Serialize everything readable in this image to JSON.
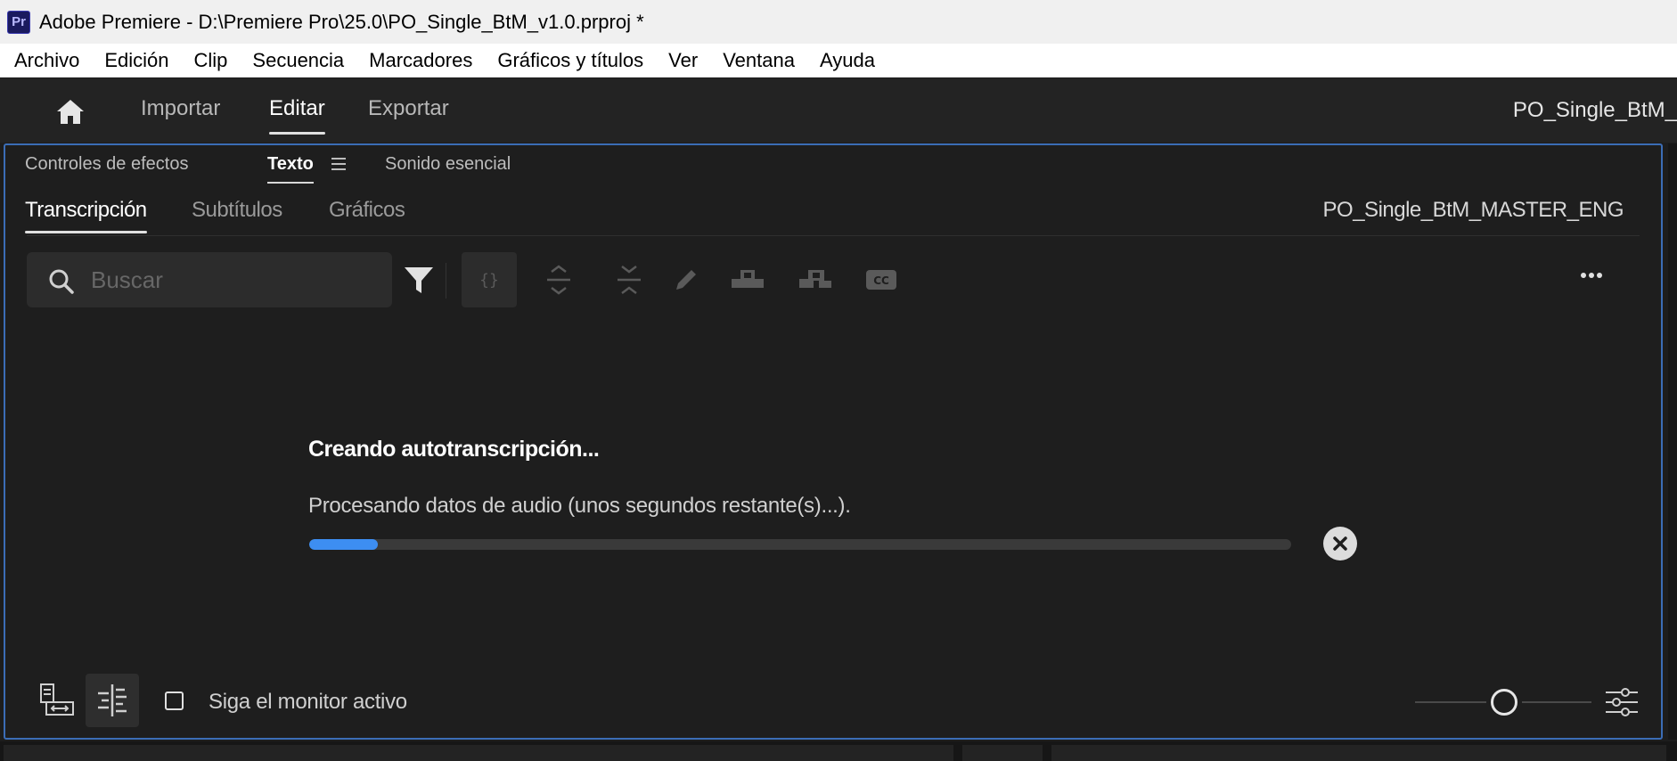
{
  "window": {
    "title": "Adobe Premiere - D:\\Premiere Pro\\25.0\\PO_Single_BtM_v1.0.prproj *",
    "app_icon": "Pr"
  },
  "menubar": [
    "Archivo",
    "Edición",
    "Clip",
    "Secuencia",
    "Marcadores",
    "Gráficos y títulos",
    "Ver",
    "Ventana",
    "Ayuda"
  ],
  "header": {
    "tabs": [
      {
        "label": "Importar",
        "active": false
      },
      {
        "label": "Editar",
        "active": true
      },
      {
        "label": "Exportar",
        "active": false
      }
    ],
    "project_name": "PO_Single_BtM_"
  },
  "panel": {
    "tabs": [
      {
        "label": "Controles de efectos",
        "active": false
      },
      {
        "label": "Texto",
        "active": true
      },
      {
        "label": "Sonido esencial",
        "active": false
      }
    ],
    "subtabs": [
      {
        "label": "Transcripción",
        "active": true
      },
      {
        "label": "Subtítulos",
        "active": false
      },
      {
        "label": "Gráficos",
        "active": false
      }
    ],
    "sequence_name": "PO_Single_BtM_MASTER_ENG",
    "search": {
      "placeholder": "Buscar",
      "value": ""
    },
    "toolbar_icons": [
      "filter-icon",
      "braces-icon",
      "expand-icon",
      "collapse-icon",
      "pencil-icon",
      "speaker-merge-icon",
      "speaker-split-icon",
      "cc-icon"
    ],
    "status": {
      "title": "Creando autotranscripción...",
      "message": "Procesando datos de audio (unos segundos restante(s)...).",
      "progress": 0.07
    },
    "footer": {
      "follow_active_monitor_label": "Siga el monitor activo",
      "follow_active_monitor_checked": false
    }
  },
  "colors": {
    "accent": "#3d8ef2",
    "panel_border": "#3b6db6"
  }
}
